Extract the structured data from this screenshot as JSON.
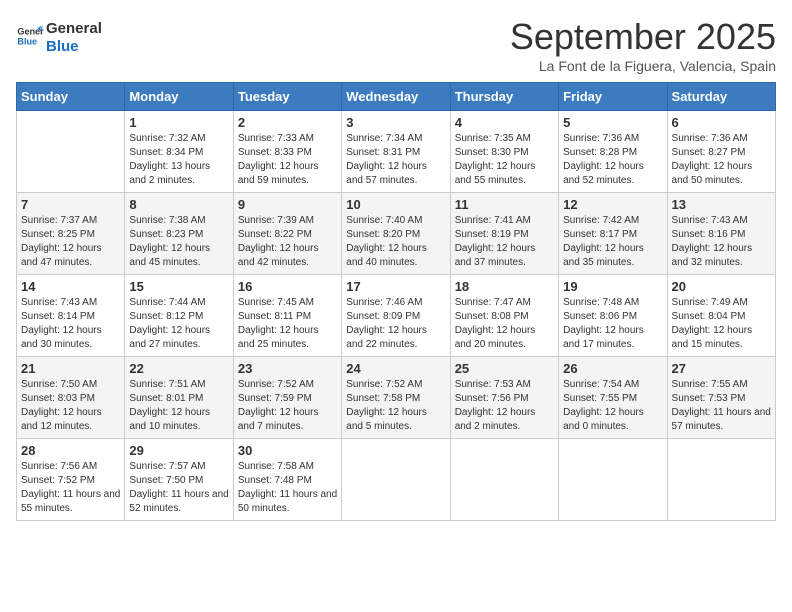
{
  "logo": {
    "line1": "General",
    "line2": "Blue"
  },
  "title": "September 2025",
  "subtitle": "La Font de la Figuera, Valencia, Spain",
  "days_of_week": [
    "Sunday",
    "Monday",
    "Tuesday",
    "Wednesday",
    "Thursday",
    "Friday",
    "Saturday"
  ],
  "weeks": [
    [
      {
        "day": "",
        "info": ""
      },
      {
        "day": "1",
        "info": "Sunrise: 7:32 AM\nSunset: 8:34 PM\nDaylight: 13 hours and 2 minutes."
      },
      {
        "day": "2",
        "info": "Sunrise: 7:33 AM\nSunset: 8:33 PM\nDaylight: 12 hours and 59 minutes."
      },
      {
        "day": "3",
        "info": "Sunrise: 7:34 AM\nSunset: 8:31 PM\nDaylight: 12 hours and 57 minutes."
      },
      {
        "day": "4",
        "info": "Sunrise: 7:35 AM\nSunset: 8:30 PM\nDaylight: 12 hours and 55 minutes."
      },
      {
        "day": "5",
        "info": "Sunrise: 7:36 AM\nSunset: 8:28 PM\nDaylight: 12 hours and 52 minutes."
      },
      {
        "day": "6",
        "info": "Sunrise: 7:36 AM\nSunset: 8:27 PM\nDaylight: 12 hours and 50 minutes."
      }
    ],
    [
      {
        "day": "7",
        "info": "Sunrise: 7:37 AM\nSunset: 8:25 PM\nDaylight: 12 hours and 47 minutes."
      },
      {
        "day": "8",
        "info": "Sunrise: 7:38 AM\nSunset: 8:23 PM\nDaylight: 12 hours and 45 minutes."
      },
      {
        "day": "9",
        "info": "Sunrise: 7:39 AM\nSunset: 8:22 PM\nDaylight: 12 hours and 42 minutes."
      },
      {
        "day": "10",
        "info": "Sunrise: 7:40 AM\nSunset: 8:20 PM\nDaylight: 12 hours and 40 minutes."
      },
      {
        "day": "11",
        "info": "Sunrise: 7:41 AM\nSunset: 8:19 PM\nDaylight: 12 hours and 37 minutes."
      },
      {
        "day": "12",
        "info": "Sunrise: 7:42 AM\nSunset: 8:17 PM\nDaylight: 12 hours and 35 minutes."
      },
      {
        "day": "13",
        "info": "Sunrise: 7:43 AM\nSunset: 8:16 PM\nDaylight: 12 hours and 32 minutes."
      }
    ],
    [
      {
        "day": "14",
        "info": "Sunrise: 7:43 AM\nSunset: 8:14 PM\nDaylight: 12 hours and 30 minutes."
      },
      {
        "day": "15",
        "info": "Sunrise: 7:44 AM\nSunset: 8:12 PM\nDaylight: 12 hours and 27 minutes."
      },
      {
        "day": "16",
        "info": "Sunrise: 7:45 AM\nSunset: 8:11 PM\nDaylight: 12 hours and 25 minutes."
      },
      {
        "day": "17",
        "info": "Sunrise: 7:46 AM\nSunset: 8:09 PM\nDaylight: 12 hours and 22 minutes."
      },
      {
        "day": "18",
        "info": "Sunrise: 7:47 AM\nSunset: 8:08 PM\nDaylight: 12 hours and 20 minutes."
      },
      {
        "day": "19",
        "info": "Sunrise: 7:48 AM\nSunset: 8:06 PM\nDaylight: 12 hours and 17 minutes."
      },
      {
        "day": "20",
        "info": "Sunrise: 7:49 AM\nSunset: 8:04 PM\nDaylight: 12 hours and 15 minutes."
      }
    ],
    [
      {
        "day": "21",
        "info": "Sunrise: 7:50 AM\nSunset: 8:03 PM\nDaylight: 12 hours and 12 minutes."
      },
      {
        "day": "22",
        "info": "Sunrise: 7:51 AM\nSunset: 8:01 PM\nDaylight: 12 hours and 10 minutes."
      },
      {
        "day": "23",
        "info": "Sunrise: 7:52 AM\nSunset: 7:59 PM\nDaylight: 12 hours and 7 minutes."
      },
      {
        "day": "24",
        "info": "Sunrise: 7:52 AM\nSunset: 7:58 PM\nDaylight: 12 hours and 5 minutes."
      },
      {
        "day": "25",
        "info": "Sunrise: 7:53 AM\nSunset: 7:56 PM\nDaylight: 12 hours and 2 minutes."
      },
      {
        "day": "26",
        "info": "Sunrise: 7:54 AM\nSunset: 7:55 PM\nDaylight: 12 hours and 0 minutes."
      },
      {
        "day": "27",
        "info": "Sunrise: 7:55 AM\nSunset: 7:53 PM\nDaylight: 11 hours and 57 minutes."
      }
    ],
    [
      {
        "day": "28",
        "info": "Sunrise: 7:56 AM\nSunset: 7:52 PM\nDaylight: 11 hours and 55 minutes."
      },
      {
        "day": "29",
        "info": "Sunrise: 7:57 AM\nSunset: 7:50 PM\nDaylight: 11 hours and 52 minutes."
      },
      {
        "day": "30",
        "info": "Sunrise: 7:58 AM\nSunset: 7:48 PM\nDaylight: 11 hours and 50 minutes."
      },
      {
        "day": "",
        "info": ""
      },
      {
        "day": "",
        "info": ""
      },
      {
        "day": "",
        "info": ""
      },
      {
        "day": "",
        "info": ""
      }
    ]
  ]
}
